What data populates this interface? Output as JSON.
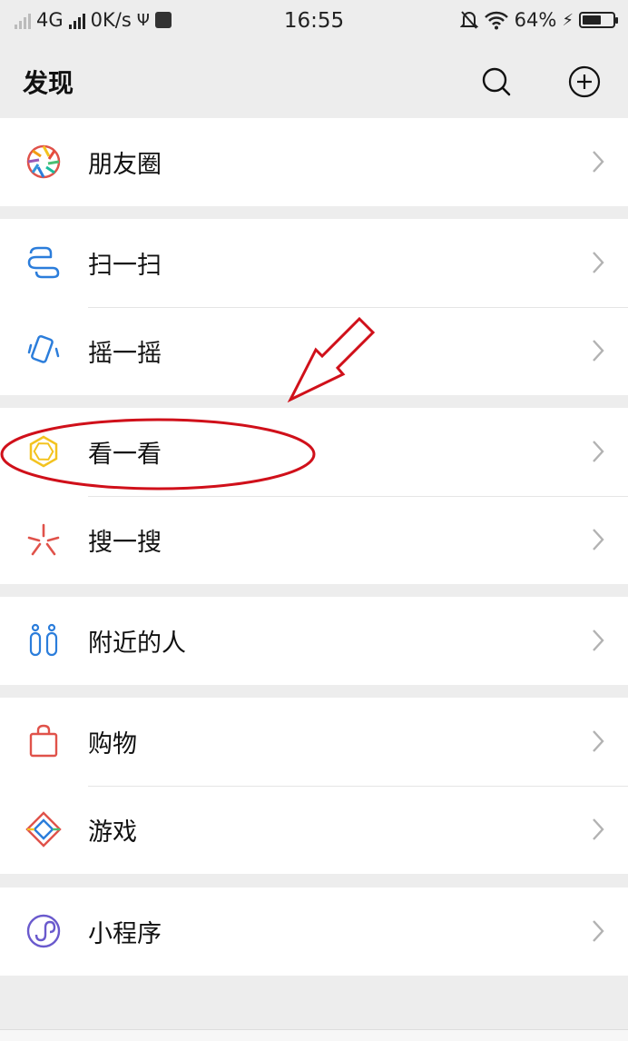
{
  "status_bar": {
    "network": "4G",
    "speed": "0K/s",
    "time": "16:55",
    "battery": "64%",
    "battery_level": 0.64
  },
  "header": {
    "title": "发现"
  },
  "menu": {
    "moments": "朋友圈",
    "scan": "扫一扫",
    "shake": "摇一摇",
    "top_stories": "看一看",
    "search": "搜一搜",
    "people_nearby": "附近的人",
    "shopping": "购物",
    "games": "游戏",
    "mini_programs": "小程序"
  },
  "colors": {
    "background": "#ededed",
    "annotation": "#d0101a",
    "scan_icon": "#2b7ddb",
    "top_stories_icon": "#f3c320",
    "search_icon": "#e0524a",
    "nearby_icon": "#2b7ddb",
    "shopping_icon": "#e0524a",
    "mini_program_icon": "#6a5acd"
  }
}
